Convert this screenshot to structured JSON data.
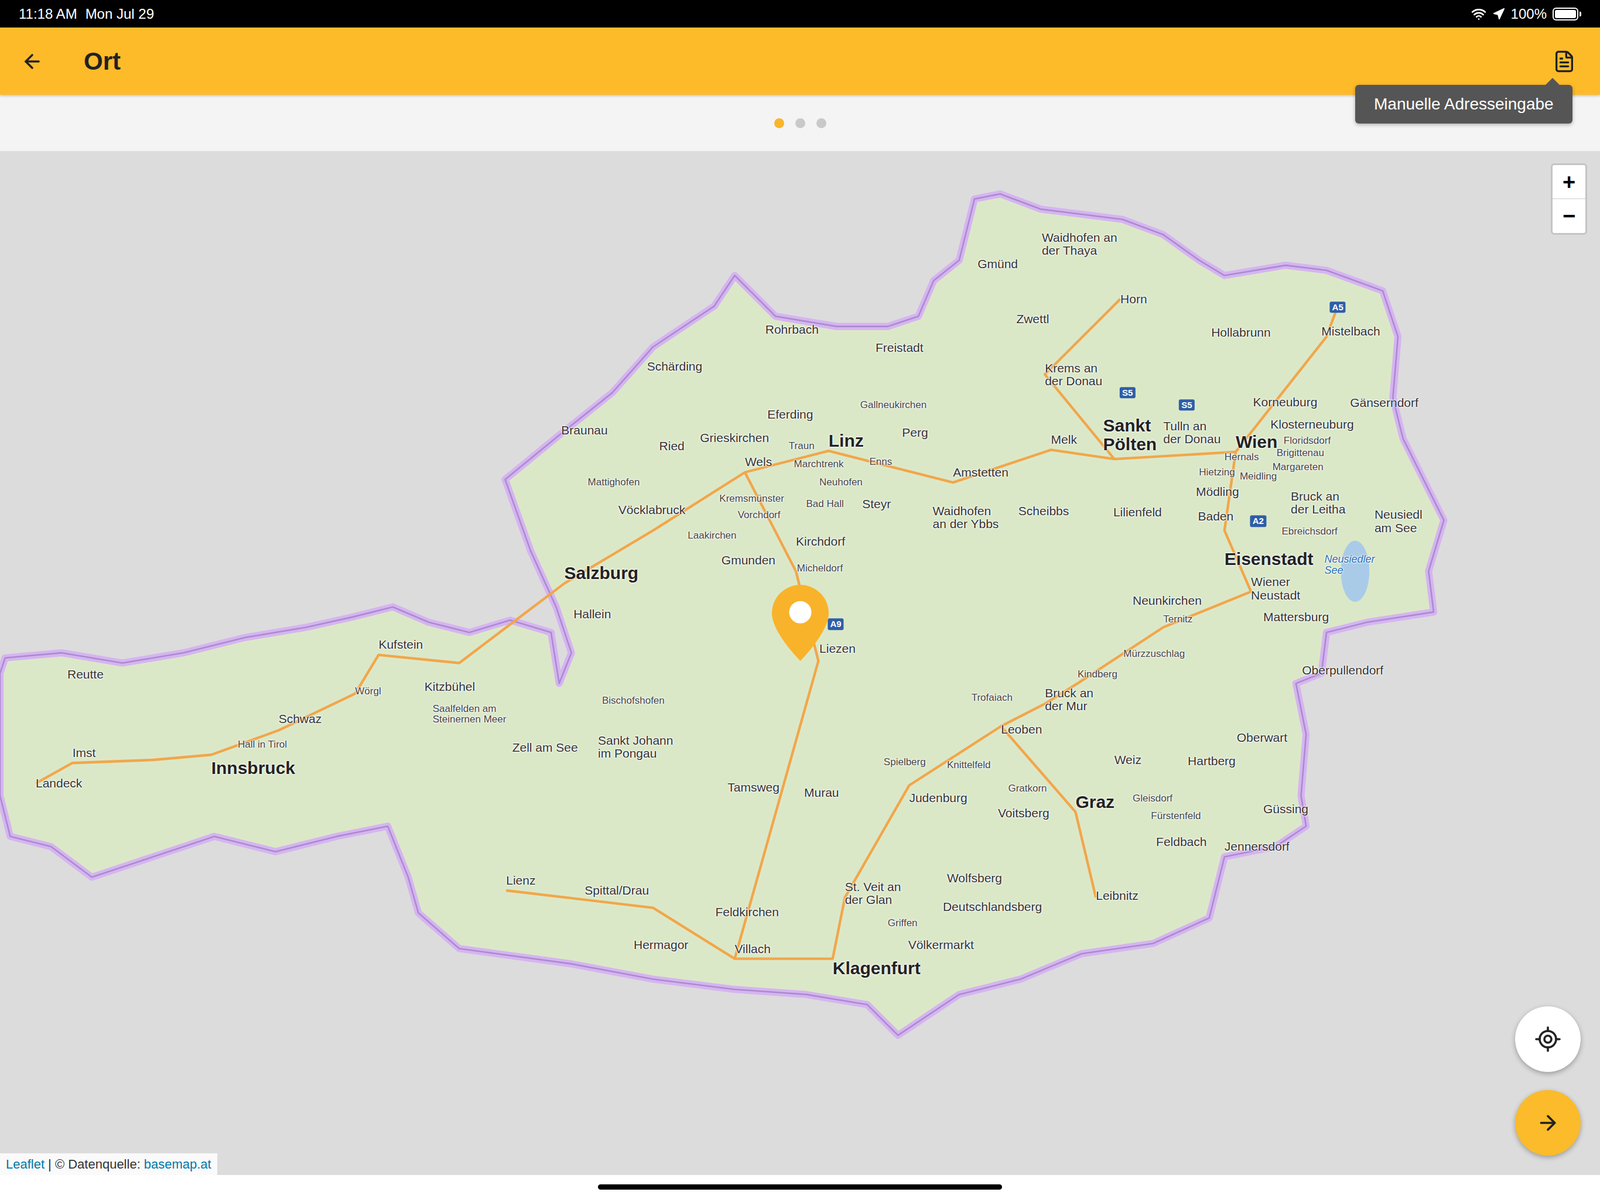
{
  "status_bar": {
    "time": "11:18 AM",
    "date": "Mon Jul 29",
    "battery": "100%",
    "battery_level": 1.0
  },
  "header": {
    "title": "Ort",
    "tooltip": "Manuelle Adresseingabe"
  },
  "pager": [
    {
      "selected": true
    },
    {
      "selected": false
    },
    {
      "selected": false
    }
  ],
  "map": {
    "zoom_in": "+",
    "zoom_out": "−",
    "shields": [
      "A5",
      "S5",
      "S5",
      "A9",
      "A2"
    ],
    "attribution": {
      "link": "Leaflet",
      "text": "| © Datenquelle:",
      "source": "basemap.at"
    },
    "places": [
      {
        "lines": [
          "Gmünd"
        ],
        "kind": "town"
      },
      {
        "lines": [
          "Waidhofen an",
          "der Thaya"
        ],
        "kind": "town"
      },
      {
        "lines": [
          "Horn"
        ],
        "kind": "town"
      },
      {
        "lines": [
          "Zwettl"
        ],
        "kind": "town"
      },
      {
        "lines": [
          "Hollabrunn"
        ],
        "kind": "town"
      },
      {
        "lines": [
          "Mistelbach"
        ],
        "kind": "town"
      },
      {
        "lines": [
          "Rohrbach"
        ],
        "kind": "town"
      },
      {
        "lines": [
          "Freistadt"
        ],
        "kind": "town"
      },
      {
        "lines": [
          "Schärding"
        ],
        "kind": "town"
      },
      {
        "lines": [
          "Krems an",
          "der Donau"
        ],
        "kind": "town"
      },
      {
        "lines": [
          "Korneuburg"
        ],
        "kind": "town"
      },
      {
        "lines": [
          "Gänserndorf"
        ],
        "kind": "town"
      },
      {
        "lines": [
          "Braunau"
        ],
        "kind": "town"
      },
      {
        "lines": [
          "Eferding"
        ],
        "kind": "town"
      },
      {
        "lines": [
          "Gallneukirchen"
        ],
        "kind": "small"
      },
      {
        "lines": [
          "Ried"
        ],
        "kind": "town"
      },
      {
        "lines": [
          "Grieskirchen"
        ],
        "kind": "town"
      },
      {
        "lines": [
          "Traun"
        ],
        "kind": "small"
      },
      {
        "lines": [
          "Linz"
        ],
        "kind": "city"
      },
      {
        "lines": [
          "Perg"
        ],
        "kind": "town"
      },
      {
        "lines": [
          "Sankt",
          "Pölten"
        ],
        "kind": "city"
      },
      {
        "lines": [
          "Tulln an",
          "der Donau"
        ],
        "kind": "town"
      },
      {
        "lines": [
          "Klosterneuburg"
        ],
        "kind": "town"
      },
      {
        "lines": [
          "Wien"
        ],
        "kind": "city"
      },
      {
        "lines": [
          "Floridsdorf"
        ],
        "kind": "small"
      },
      {
        "lines": [
          "Brigittenau"
        ],
        "kind": "small"
      },
      {
        "lines": [
          "Hernals"
        ],
        "kind": "small"
      },
      {
        "lines": [
          "Margareten"
        ],
        "kind": "small"
      },
      {
        "lines": [
          "Hietzing"
        ],
        "kind": "small"
      },
      {
        "lines": [
          "Meidling"
        ],
        "kind": "small"
      },
      {
        "lines": [
          "Melk"
        ],
        "kind": "town"
      },
      {
        "lines": [
          "Wels"
        ],
        "kind": "town"
      },
      {
        "lines": [
          "Marchtrenk"
        ],
        "kind": "small"
      },
      {
        "lines": [
          "Enns"
        ],
        "kind": "small"
      },
      {
        "lines": [
          "Mattighofen"
        ],
        "kind": "small"
      },
      {
        "lines": [
          "Neuhofen"
        ],
        "kind": "small"
      },
      {
        "lines": [
          "Amstetten"
        ],
        "kind": "town"
      },
      {
        "lines": [
          "Kremsmünster"
        ],
        "kind": "small"
      },
      {
        "lines": [
          "Bad Hall"
        ],
        "kind": "small"
      },
      {
        "lines": [
          "Steyr"
        ],
        "kind": "town"
      },
      {
        "lines": [
          "Vöcklabruck"
        ],
        "kind": "town"
      },
      {
        "lines": [
          "Vorchdorf"
        ],
        "kind": "small"
      },
      {
        "lines": [
          "Waidhofen",
          "an der Ybbs"
        ],
        "kind": "town"
      },
      {
        "lines": [
          "Scheibbs"
        ],
        "kind": "town"
      },
      {
        "lines": [
          "Lilienfeld"
        ],
        "kind": "town"
      },
      {
        "lines": [
          "Mödling"
        ],
        "kind": "town"
      },
      {
        "lines": [
          "Bruck an",
          "der Leitha"
        ],
        "kind": "town"
      },
      {
        "lines": [
          "Baden"
        ],
        "kind": "town"
      },
      {
        "lines": [
          "Neusiedl",
          "am See"
        ],
        "kind": "town"
      },
      {
        "lines": [
          "Laakirchen"
        ],
        "kind": "small"
      },
      {
        "lines": [
          "Kirchdorf"
        ],
        "kind": "town"
      },
      {
        "lines": [
          "Ebreichsdorf"
        ],
        "kind": "small"
      },
      {
        "lines": [
          "Gmunden"
        ],
        "kind": "town"
      },
      {
        "lines": [
          "Micheldorf"
        ],
        "kind": "small"
      },
      {
        "lines": [
          "Eisenstadt"
        ],
        "kind": "city"
      },
      {
        "lines": [
          "Neusiedler",
          "See"
        ],
        "kind": "water"
      },
      {
        "lines": [
          "Salzburg"
        ],
        "kind": "city"
      },
      {
        "lines": [
          "Wiener",
          "Neustadt"
        ],
        "kind": "town"
      },
      {
        "lines": [
          "Neunkirchen"
        ],
        "kind": "town"
      },
      {
        "lines": [
          "Mattersburg"
        ],
        "kind": "town"
      },
      {
        "lines": [
          "Hallein"
        ],
        "kind": "town"
      },
      {
        "lines": [
          "Ternitz"
        ],
        "kind": "small"
      },
      {
        "lines": [
          "Liezen"
        ],
        "kind": "town"
      },
      {
        "lines": [
          "Kufstein"
        ],
        "kind": "town"
      },
      {
        "lines": [
          "Mürzzuschlag"
        ],
        "kind": "small"
      },
      {
        "lines": [
          "Reutte"
        ],
        "kind": "town"
      },
      {
        "lines": [
          "Kindberg"
        ],
        "kind": "small"
      },
      {
        "lines": [
          "Oberpullendorf"
        ],
        "kind": "town"
      },
      {
        "lines": [
          "Kitzbühel"
        ],
        "kind": "town"
      },
      {
        "lines": [
          "Wörgl"
        ],
        "kind": "small"
      },
      {
        "lines": [
          "Trofaiach"
        ],
        "kind": "small"
      },
      {
        "lines": [
          "Bruck an",
          "der Mur"
        ],
        "kind": "town"
      },
      {
        "lines": [
          "Bischofshofen"
        ],
        "kind": "small"
      },
      {
        "lines": [
          "Saalfelden am",
          "Steinernen Meer"
        ],
        "kind": "small"
      },
      {
        "lines": [
          "Schwaz"
        ],
        "kind": "town"
      },
      {
        "lines": [
          "Leoben"
        ],
        "kind": "town"
      },
      {
        "lines": [
          "Oberwart"
        ],
        "kind": "town"
      },
      {
        "lines": [
          "Hall in Tirol"
        ],
        "kind": "small"
      },
      {
        "lines": [
          "Sankt Johann",
          "im Pongau"
        ],
        "kind": "town"
      },
      {
        "lines": [
          "Zell am See"
        ],
        "kind": "town"
      },
      {
        "lines": [
          "Imst"
        ],
        "kind": "town"
      },
      {
        "lines": [
          "Innsbruck"
        ],
        "kind": "city"
      },
      {
        "lines": [
          "Weiz"
        ],
        "kind": "town"
      },
      {
        "lines": [
          "Hartberg"
        ],
        "kind": "town"
      },
      {
        "lines": [
          "Landeck"
        ],
        "kind": "town"
      },
      {
        "lines": [
          "Tamsweg"
        ],
        "kind": "town"
      },
      {
        "lines": [
          "Murau"
        ],
        "kind": "town"
      },
      {
        "lines": [
          "Spielberg"
        ],
        "kind": "small"
      },
      {
        "lines": [
          "Knittelfeld"
        ],
        "kind": "small"
      },
      {
        "lines": [
          "Judenburg"
        ],
        "kind": "town"
      },
      {
        "lines": [
          "Gratkorn"
        ],
        "kind": "small"
      },
      {
        "lines": [
          "Graz"
        ],
        "kind": "city"
      },
      {
        "lines": [
          "Voitsberg"
        ],
        "kind": "town"
      },
      {
        "lines": [
          "Gleisdorf"
        ],
        "kind": "small"
      },
      {
        "lines": [
          "Güssing"
        ],
        "kind": "town"
      },
      {
        "lines": [
          "Fürstenfeld"
        ],
        "kind": "small"
      },
      {
        "lines": [
          "Feldbach"
        ],
        "kind": "town"
      },
      {
        "lines": [
          "Jennersdorf"
        ],
        "kind": "town"
      },
      {
        "lines": [
          "Lienz"
        ],
        "kind": "town"
      },
      {
        "lines": [
          "Spittal/Drau"
        ],
        "kind": "town"
      },
      {
        "lines": [
          "Wolfsberg"
        ],
        "kind": "town"
      },
      {
        "lines": [
          "St. Veit an",
          "der Glan"
        ],
        "kind": "town"
      },
      {
        "lines": [
          "Leibnitz"
        ],
        "kind": "town"
      },
      {
        "lines": [
          "Feldkirchen"
        ],
        "kind": "town"
      },
      {
        "lines": [
          "Deutschlandsberg"
        ],
        "kind": "town"
      },
      {
        "lines": [
          "Griffen"
        ],
        "kind": "small"
      },
      {
        "lines": [
          "Hermagor"
        ],
        "kind": "town"
      },
      {
        "lines": [
          "Völkermarkt"
        ],
        "kind": "town"
      },
      {
        "lines": [
          "Villach"
        ],
        "kind": "town"
      },
      {
        "lines": [
          "Klagenfurt"
        ],
        "kind": "city"
      }
    ]
  }
}
